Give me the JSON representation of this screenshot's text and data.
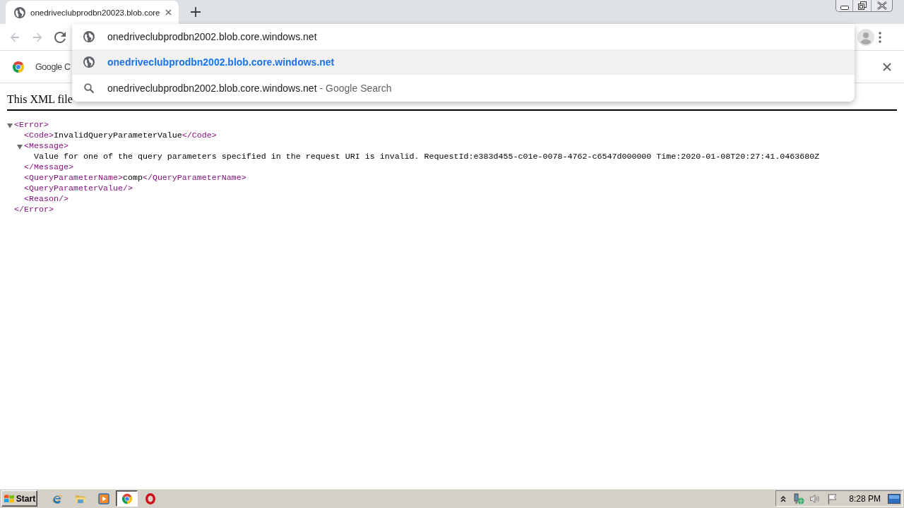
{
  "tabs": [
    {
      "title": "onedriveclubprodbn20023.blob.core",
      "selected": true
    }
  ],
  "nav": [
    {
      "kind": "back",
      "disabled": true
    },
    {
      "kind": "forward",
      "disabled": true
    },
    {
      "kind": "reload",
      "disabled": false
    }
  ],
  "omnibox": {
    "value": "onedriveclubprodbn2002.blob.core.windows.net"
  },
  "suggestions": [
    {
      "kind": "url",
      "text": "onedriveclubprodbn2002.blob.core.windows.net",
      "selected": true
    },
    {
      "kind": "search",
      "text": "onedriveclubprodbn2002.blob.core.windows.net",
      "hint": "- Google Search",
      "selected": false
    }
  ],
  "infobar": {
    "text": "Google C"
  },
  "page": {
    "notice": "This XML file",
    "tree": [
      {
        "open": "<Error>",
        "close": "</Error>",
        "expanded": true,
        "children": [
          {
            "open": "<Code>",
            "text": "InvalidQueryParameterValue",
            "close": "</Code>"
          },
          {
            "open": "<Message>",
            "close": "</Message>",
            "expanded": true,
            "children": [
              {
                "text": "Value for one of the query parameters specified in the request URI is invalid. RequestId:e383d455-c01e-0078-4762-c6547d000000 Time:2020-01-08T20:27:41.0463680Z"
              }
            ]
          },
          {
            "open": "<QueryParameterName>",
            "text": "comp",
            "close": "</QueryParameterName>"
          },
          {
            "open": "<QueryParameterValue/>"
          },
          {
            "open": "<Reason/>"
          }
        ]
      }
    ]
  },
  "taskbar": {
    "start": "Start",
    "apps": [
      {
        "kind": "ie",
        "selected": false
      },
      {
        "kind": "folder",
        "selected": false
      },
      {
        "kind": "media",
        "selected": false
      },
      {
        "kind": "chrome",
        "selected": true
      },
      {
        "kind": "opera",
        "selected": false
      }
    ],
    "clock": "8:28 PM"
  }
}
